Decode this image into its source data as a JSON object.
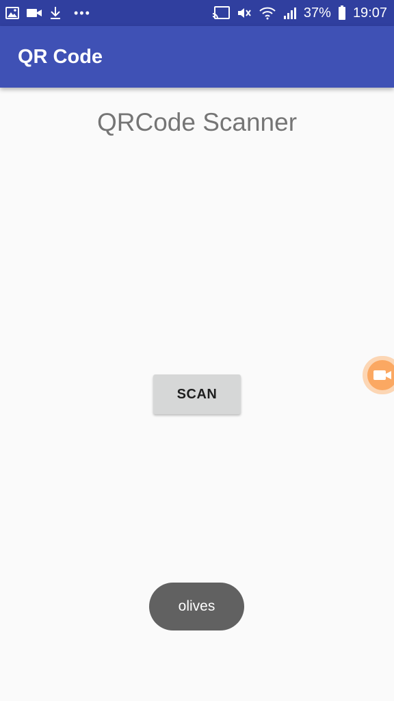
{
  "status_bar": {
    "battery_percent": "37%",
    "time": "19:07",
    "left_icons": [
      "image-icon",
      "video-camera-icon",
      "download-icon",
      "more-dots-icon"
    ],
    "right_icons": [
      "cast-icon",
      "mute-icon",
      "wifi-icon",
      "signal-icon",
      "battery-icon"
    ]
  },
  "app_bar": {
    "title": "QR Code",
    "color": "#3f51b5",
    "status_color": "#303f9f"
  },
  "main": {
    "heading": "QRCode Scanner",
    "scan_button_label": "SCAN"
  },
  "toast": {
    "message": "olives"
  },
  "floating_button": {
    "icon": "video-record-icon",
    "color": "#fba862"
  }
}
